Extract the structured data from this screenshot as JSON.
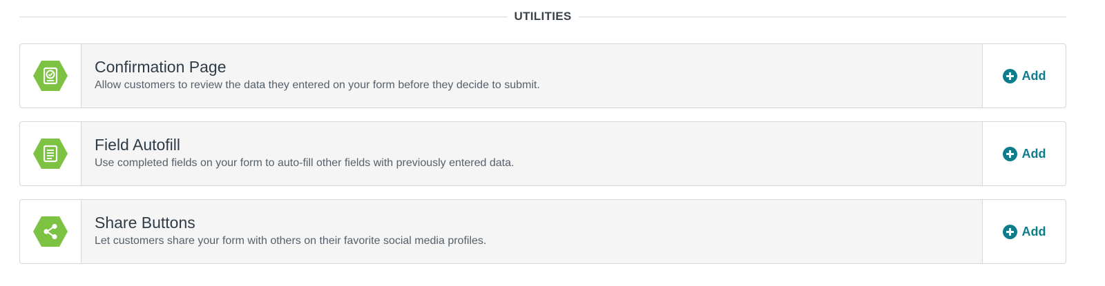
{
  "section": {
    "title": "UTILITIES"
  },
  "colors": {
    "hex_green": "#7dc242",
    "accent_teal": "#0d7d8c"
  },
  "cards": [
    {
      "icon": "confirmation-page-icon",
      "title": "Confirmation Page",
      "description": "Allow customers to review the data they entered on your form before they decide to submit.",
      "action_label": "Add"
    },
    {
      "icon": "field-autofill-icon",
      "title": "Field Autofill",
      "description": "Use completed fields on your form to auto-fill other fields with previously entered data.",
      "action_label": "Add"
    },
    {
      "icon": "share-icon",
      "title": "Share Buttons",
      "description": "Let customers share your form with others on their favorite social media profiles.",
      "action_label": "Add"
    }
  ]
}
